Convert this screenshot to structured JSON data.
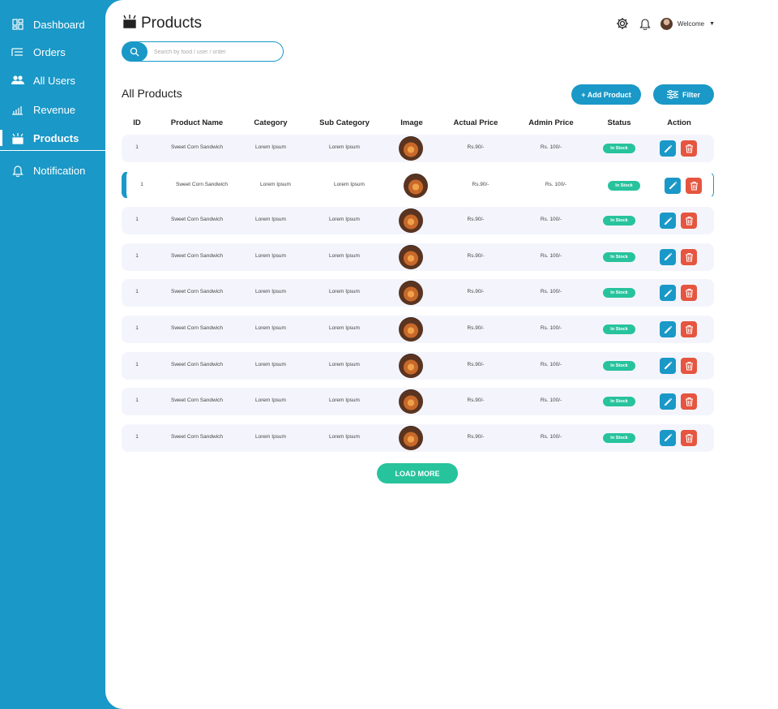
{
  "sidebar": {
    "items": [
      {
        "label": "Dashboard",
        "icon": "dashboard-icon"
      },
      {
        "label": "Orders",
        "icon": "orders-icon"
      },
      {
        "label": "All Users",
        "icon": "users-icon"
      },
      {
        "label": "Revenue",
        "icon": "revenue-icon"
      },
      {
        "label": "Products",
        "icon": "products-icon",
        "active": true
      },
      {
        "label": "Notification",
        "icon": "bell-icon"
      }
    ]
  },
  "header": {
    "title": "Products",
    "welcome": "Welcome"
  },
  "search": {
    "placeholder": "Search by food / user / order"
  },
  "section": {
    "title": "All Products",
    "add_label": "+ Add Product",
    "filter_label": "Filter"
  },
  "table": {
    "columns": [
      "ID",
      "Product Name",
      "Category",
      "Sub Category",
      "Image",
      "Actual Price",
      "Admin Price",
      "Status",
      "Action"
    ],
    "rows": [
      {
        "id": "1",
        "name": "Sweet Corn Sandwich",
        "category": "Lorem Ipsum",
        "sub_category": "Lorem Ipsum",
        "actual_price": "Rs.90/-",
        "admin_price": "Rs. 100/-",
        "status": "In Stock"
      },
      {
        "id": "1",
        "name": "Sweet Corn Sandwich",
        "category": "Lorem Ipsum",
        "sub_category": "Lorem Ipsum",
        "actual_price": "Rs.90/-",
        "admin_price": "Rs. 100/-",
        "status": "In Stock"
      },
      {
        "id": "1",
        "name": "Sweet Corn Sandwich",
        "category": "Lorem Ipsum",
        "sub_category": "Lorem Ipsum",
        "actual_price": "Rs.90/-",
        "admin_price": "Rs. 100/-",
        "status": "In Stock"
      },
      {
        "id": "1",
        "name": "Sweet Corn Sandwich",
        "category": "Lorem Ipsum",
        "sub_category": "Lorem Ipsum",
        "actual_price": "Rs.90/-",
        "admin_price": "Rs. 100/-",
        "status": "In Stock"
      },
      {
        "id": "1",
        "name": "Sweet Corn Sandwich",
        "category": "Lorem Ipsum",
        "sub_category": "Lorem Ipsum",
        "actual_price": "Rs.90/-",
        "admin_price": "Rs. 100/-",
        "status": "In Stock"
      },
      {
        "id": "1",
        "name": "Sweet Corn Sandwich",
        "category": "Lorem Ipsum",
        "sub_category": "Lorem Ipsum",
        "actual_price": "Rs.90/-",
        "admin_price": "Rs. 100/-",
        "status": "In Stock"
      },
      {
        "id": "1",
        "name": "Sweet Corn Sandwich",
        "category": "Lorem Ipsum",
        "sub_category": "Lorem Ipsum",
        "actual_price": "Rs.90/-",
        "admin_price": "Rs. 100/-",
        "status": "In Stock"
      },
      {
        "id": "1",
        "name": "Sweet Corn Sandwich",
        "category": "Lorem Ipsum",
        "sub_category": "Lorem Ipsum",
        "actual_price": "Rs.90/-",
        "admin_price": "Rs. 100/-",
        "status": "In Stock"
      },
      {
        "id": "1",
        "name": "Sweet Corn Sandwich",
        "category": "Lorem Ipsum",
        "sub_category": "Lorem Ipsum",
        "actual_price": "Rs.90/-",
        "admin_price": "Rs. 100/-",
        "status": "In Stock"
      }
    ]
  },
  "load_more": "LOAD MORE",
  "colors": {
    "primary": "#1a98c7",
    "success": "#27c39d",
    "danger": "#e5553f",
    "row_bg": "#f4f5fc"
  }
}
